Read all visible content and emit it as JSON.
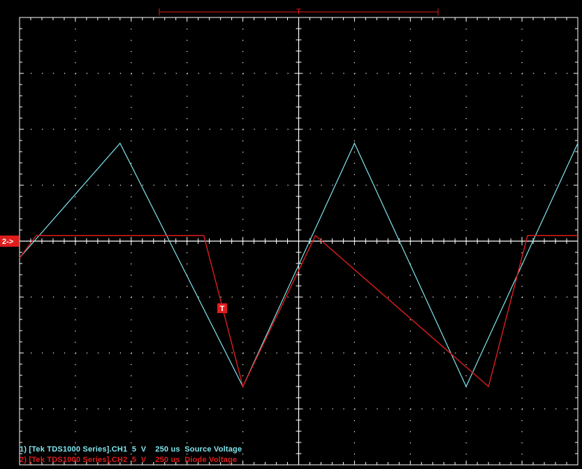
{
  "chart_data": {
    "type": "line",
    "title": "",
    "xlabel": "",
    "ylabel": "",
    "grid": true,
    "divisions": {
      "x": 10,
      "y": 8
    },
    "xlim": [
      0,
      10
    ],
    "ylim": [
      -4,
      4
    ],
    "trigger_marker": "T",
    "ch2_ground_marker": "2->",
    "series": [
      {
        "channel": "CH1",
        "color": "#7fe6ee",
        "x": [
          0.0,
          1.8,
          4.0,
          6.0,
          8.0,
          10.0
        ],
        "y": [
          -0.3,
          1.75,
          -2.6,
          1.75,
          -2.6,
          1.75
        ]
      },
      {
        "channel": "CH2",
        "color": "#e01c1c",
        "x": [
          0.0,
          0.3,
          3.3,
          4.0,
          5.3,
          8.4,
          9.1,
          10.0
        ],
        "y": [
          -0.3,
          0.1,
          0.1,
          -2.6,
          0.1,
          -2.6,
          0.1,
          0.1
        ]
      }
    ],
    "legend": [
      {
        "text": "1) [Tek TDS1000 Series].CH1  5  V    250 us  Source Voltage",
        "color": "#7fe6ee"
      },
      {
        "text": "2) [Tek TDS1000 Series].CH2  5  V    250 us  Diode Voltage",
        "color": "#e01c1c"
      }
    ]
  },
  "colors": {
    "background": "#000000",
    "grid": "#ffffff",
    "ch1": "#7fe6ee",
    "ch2": "#e01c1c"
  }
}
